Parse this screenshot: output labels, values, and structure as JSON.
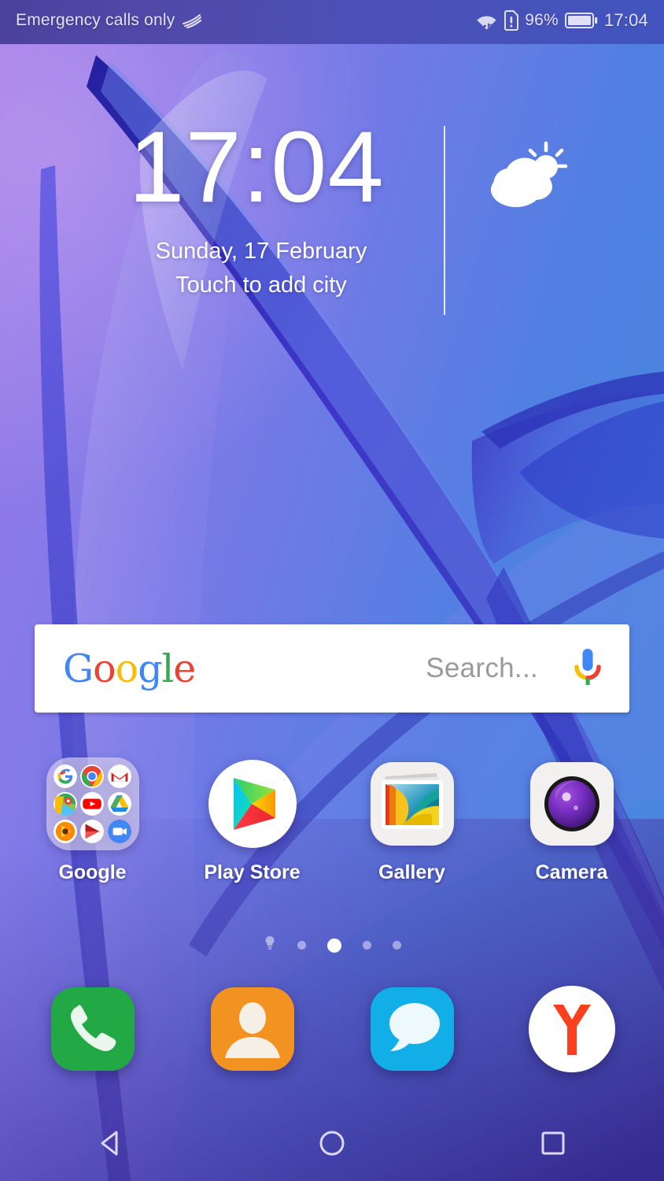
{
  "status_bar": {
    "carrier_text": "Emergency calls only",
    "carrier_icon": "signal-waves-icon",
    "wifi_icon": "wifi-icon",
    "sim_icon": "sim-card-alert-icon",
    "battery_percent": "96%",
    "battery_icon": "battery-full-icon",
    "time": "17:04"
  },
  "clock_widget": {
    "time": "17:04",
    "date": "Sunday, 17 February",
    "city_prompt": "Touch to add city",
    "weather_icon": "partly-cloudy-icon"
  },
  "search": {
    "logo_text": "Google",
    "logo_letters": [
      {
        "char": "G",
        "color": "#4285F4"
      },
      {
        "char": "o",
        "color": "#EA4335"
      },
      {
        "char": "o",
        "color": "#FBBC05"
      },
      {
        "char": "g",
        "color": "#4285F4"
      },
      {
        "char": "l",
        "color": "#34A853"
      },
      {
        "char": "e",
        "color": "#EA4335"
      }
    ],
    "placeholder": "Search...",
    "mic_icon": "microphone-icon"
  },
  "apps": [
    {
      "label": "Google",
      "icon": "google-folder-icon",
      "type": "folder",
      "contents": [
        "google-icon",
        "chrome-icon",
        "gmail-icon",
        "maps-icon",
        "youtube-icon",
        "drive-icon",
        "play-music-icon",
        "play-movies-icon",
        "duo-icon"
      ]
    },
    {
      "label": "Play Store",
      "icon": "play-store-icon",
      "type": "app"
    },
    {
      "label": "Gallery",
      "icon": "gallery-icon",
      "type": "app"
    },
    {
      "label": "Camera",
      "icon": "camera-icon",
      "type": "app"
    }
  ],
  "page_indicator": {
    "total_pages": 5,
    "active_page": 3,
    "first_is_widget_page": true,
    "widget_icon": "lightbulb-icon"
  },
  "dock": [
    {
      "label": "Phone",
      "icon": "phone-icon",
      "color": "#22A845"
    },
    {
      "label": "Contacts",
      "icon": "contacts-icon",
      "color": "#F29220"
    },
    {
      "label": "Messages",
      "icon": "messages-icon",
      "color": "#12AEE8"
    },
    {
      "label": "Yandex Browser",
      "icon": "yandex-icon",
      "color": "#FC3F1D"
    }
  ],
  "nav_bar": [
    {
      "name": "back",
      "icon": "back-triangle-icon"
    },
    {
      "name": "home",
      "icon": "home-circle-icon"
    },
    {
      "name": "recents",
      "icon": "recents-square-icon"
    }
  ],
  "colors": {
    "wallpaper_purple": "#8f7ae8",
    "wallpaper_blue": "#4a7fe0",
    "wallpaper_deep": "#2f2c9c",
    "status_text": "#e3e0f5",
    "accent_white": "#ffffff"
  }
}
